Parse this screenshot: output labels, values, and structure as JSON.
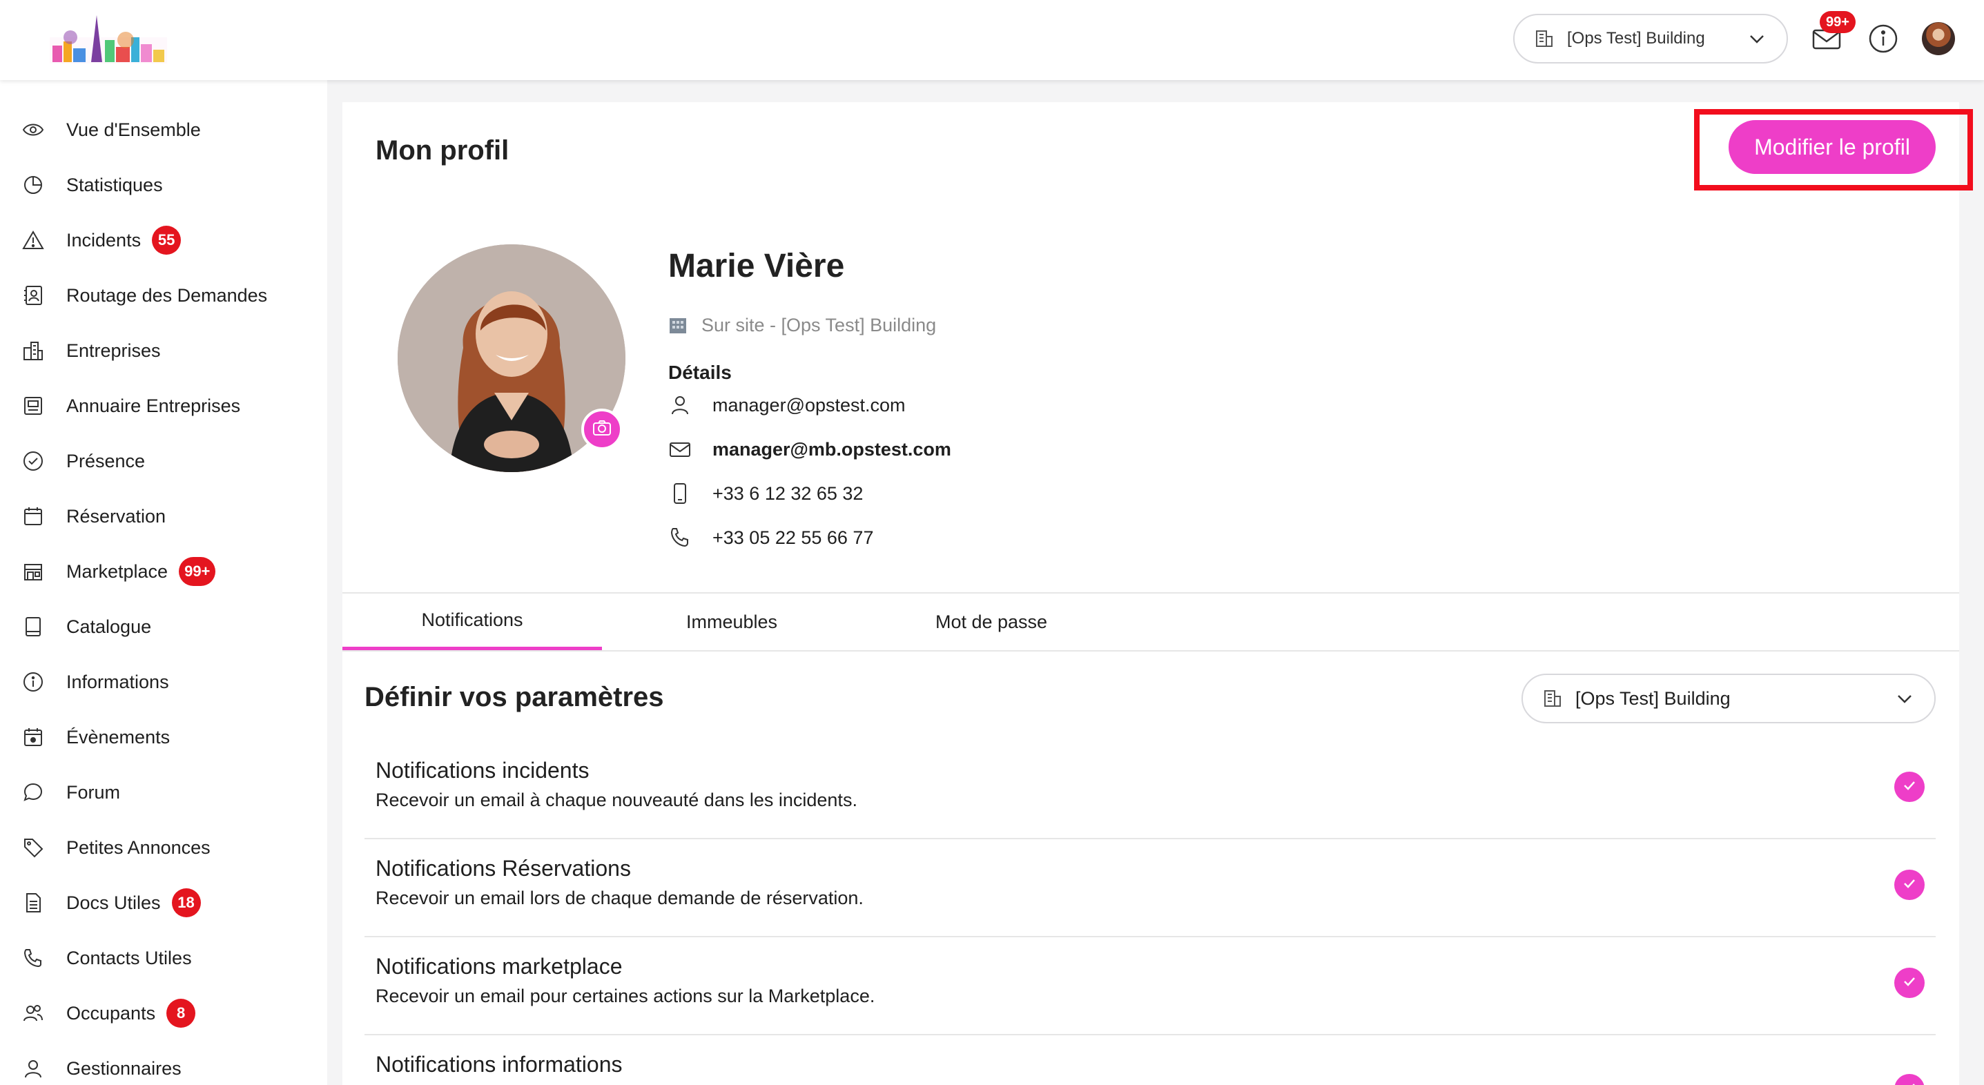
{
  "topbar": {
    "building_select": "[Ops Test] Building",
    "mail_badge": "99+",
    "icons": [
      "building-icon",
      "chevron-down-icon",
      "mail-icon",
      "info-icon",
      "user-avatar"
    ]
  },
  "sidebar": {
    "items": [
      {
        "label": "Vue d'Ensemble",
        "icon": "eye-icon"
      },
      {
        "label": "Statistiques",
        "icon": "pie-chart-icon"
      },
      {
        "label": "Incidents",
        "icon": "warning-icon",
        "badge": "55"
      },
      {
        "label": "Routage des Demandes",
        "icon": "contact-book-icon"
      },
      {
        "label": "Entreprises",
        "icon": "buildings-icon"
      },
      {
        "label": "Annuaire Entreprises",
        "icon": "directory-icon"
      },
      {
        "label": "Présence",
        "icon": "check-circle-icon"
      },
      {
        "label": "Réservation",
        "icon": "calendar-icon"
      },
      {
        "label": "Marketplace",
        "icon": "store-icon",
        "badge": "99+"
      },
      {
        "label": "Catalogue",
        "icon": "book-icon"
      },
      {
        "label": "Informations",
        "icon": "info-icon"
      },
      {
        "label": "Évènements",
        "icon": "calendar-event-icon"
      },
      {
        "label": "Forum",
        "icon": "chat-bubble-icon"
      },
      {
        "label": "Petites Annonces",
        "icon": "tag-icon"
      },
      {
        "label": "Docs Utiles",
        "icon": "document-icon",
        "badge": "18"
      },
      {
        "label": "Contacts Utiles",
        "icon": "phone-sos-icon"
      },
      {
        "label": "Occupants",
        "icon": "users-icon",
        "badge": "8"
      },
      {
        "label": "Gestionnaires",
        "icon": "user-icon"
      }
    ]
  },
  "main": {
    "title": "Mon profil",
    "edit_button": "Modifier le profil",
    "profile": {
      "name": "Marie Vière",
      "site": "Sur site - [Ops Test] Building",
      "details_label": "Détails",
      "username": "manager@opstest.com",
      "email": "manager@mb.opstest.com",
      "mobile": "+33 6 12 32 65 32",
      "phone": "+33 05 22 55 66 77"
    },
    "tabs": [
      "Notifications",
      "Immeubles",
      "Mot de passe"
    ],
    "section_title": "Définir vos paramètres",
    "building_select": "[Ops Test] Building",
    "notifications": [
      {
        "title": "Notifications incidents",
        "desc": "Recevoir un email à chaque nouveauté dans les incidents.",
        "checked": true
      },
      {
        "title": "Notifications Réservations",
        "desc": "Recevoir un email lors de chaque demande de réservation.",
        "checked": true
      },
      {
        "title": "Notifications marketplace",
        "desc": "Recevoir un email pour certaines actions sur la Marketplace.",
        "checked": true
      },
      {
        "title": "Notifications informations",
        "desc": "",
        "checked": true
      }
    ]
  },
  "colors": {
    "accent": "#ee3ec8",
    "badge": "#e4151f",
    "highlight": "#f20d1d"
  }
}
